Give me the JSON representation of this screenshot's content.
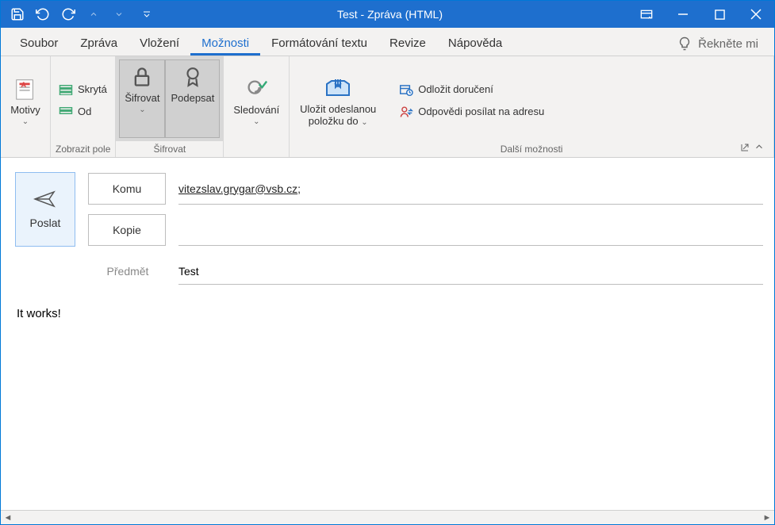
{
  "title": "Test  -  Zpráva (HTML)",
  "tabs": {
    "file": "Soubor",
    "message": "Zpráva",
    "insert": "Vložení",
    "options": "Možnosti",
    "format": "Formátování textu",
    "review": "Revize",
    "help": "Nápověda",
    "tellme": "Řekněte mi"
  },
  "ribbon": {
    "themes": {
      "label": "Motivy"
    },
    "showfields": {
      "bcc": "Skrytá",
      "from": "Od",
      "group": "Zobrazit pole"
    },
    "encrypt": {
      "encrypt": "Šifrovat",
      "sign": "Podepsat",
      "group": "Šifrovat"
    },
    "tracking": {
      "label": "Sledování"
    },
    "more": {
      "save": "Uložit odeslanou položku do",
      "delay": "Odložit doručení",
      "replyto": "Odpovědi posílat na adresu",
      "group": "Další možnosti"
    }
  },
  "compose": {
    "send": "Poslat",
    "to_btn": "Komu",
    "cc_btn": "Kopie",
    "to_val": "vitezslav.grygar@vsb.cz",
    "subject_label": "Předmět",
    "subject_val": "Test",
    "body": "It works!"
  }
}
